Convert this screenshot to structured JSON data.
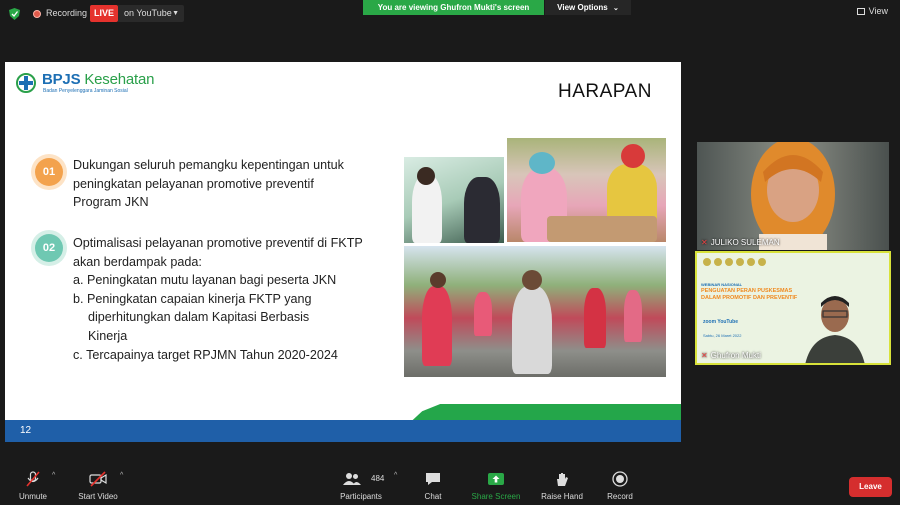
{
  "topbar": {
    "recording_label": "Recording",
    "live_label": "LIVE",
    "youtube_label": "on YouTube",
    "viewing_label": "You are viewing Ghufron Mukti's screen",
    "view_options_label": "View Options",
    "view_label": "View"
  },
  "slide": {
    "logo_name_a": "BPJS",
    "logo_name_b": " Kesehatan",
    "logo_sub": "Badan Penyelenggara Jaminan Sosial",
    "title": "HARAPAN",
    "point1_num": "01",
    "point1_text": "Dukungan seluruh pemangku kepentingan untuk peningkatan pelayanan promotive preventif Program JKN",
    "point2_num": "02",
    "point2_text": "Optimalisasi pelayanan promotive preventif di FKTP akan berdampak pada:",
    "sub_a": "a. Peningkatan mutu layanan bagi peserta JKN",
    "sub_b1": "b. Peningkatan capaian kinerja FKTP yang",
    "sub_b2": "diperhitungkan dalam Kapitasi Berbasis",
    "sub_b3": "Kinerja",
    "sub_c": "c. Tercapainya target RPJMN Tahun 2020-2024",
    "page_number": "12"
  },
  "participants_panel": {
    "tile1_name": "JULIKO SULEMAN",
    "tile2_name": "Ghufron Mukti",
    "tile2_banner_small": "WEBINAR NASIONAL",
    "tile2_banner": "PENGUATAN PERAN PUSKESMAS DALAM PROMOTIF DAN PREVENTIF",
    "tile2_zoom": "zoom  YouTube",
    "tile2_date": "Sabtu, 26 Maret 2022"
  },
  "toolbar": {
    "unmute_label": "Unmute",
    "start_video_label": "Start Video",
    "participants_count": "484",
    "participants_label": "Participants",
    "chat_label": "Chat",
    "share_screen_label": "Share Screen",
    "raise_hand_label": "Raise Hand",
    "record_label": "Record",
    "leave_label": "Leave"
  },
  "colors": {
    "accent_green": "#2aa847",
    "live_red": "#e5322d",
    "leave_red": "#d52e2e",
    "brand_blue": "#1f5fa8",
    "active_tile_border": "#d8e23a"
  },
  "icons": [
    "shield-icon",
    "recording-dot-icon",
    "view-grid-icon",
    "mic-muted-icon",
    "video-off-icon",
    "participants-icon",
    "chat-icon",
    "share-screen-icon",
    "raise-hand-icon",
    "record-icon"
  ]
}
